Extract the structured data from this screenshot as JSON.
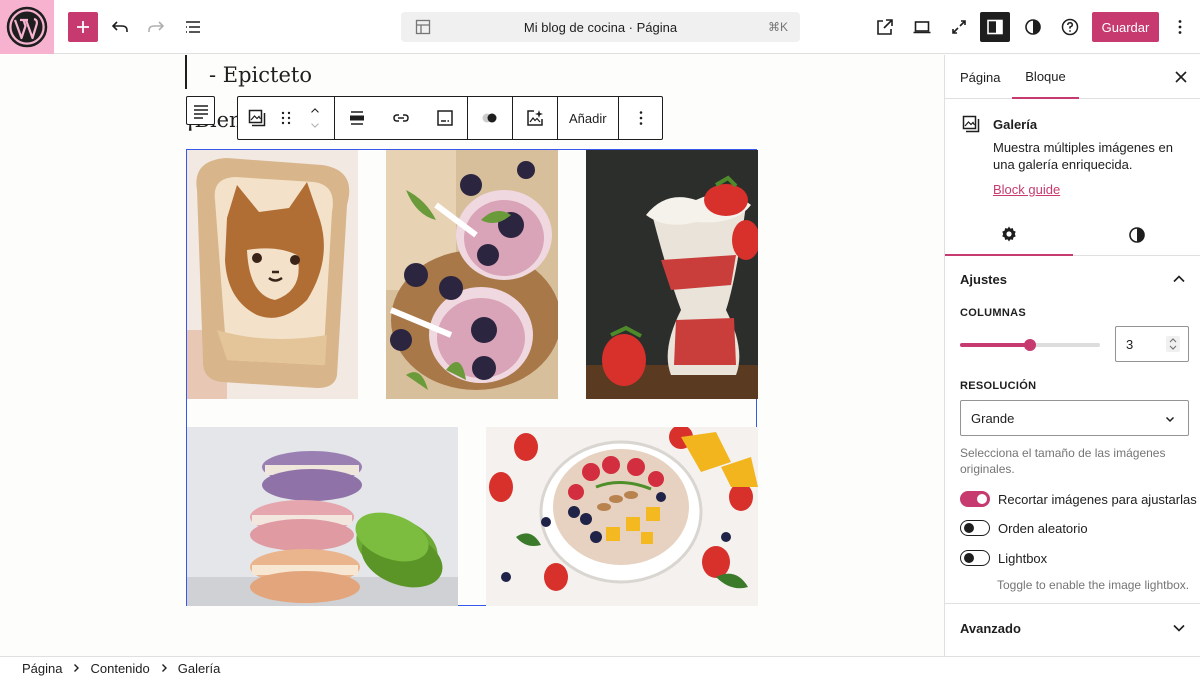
{
  "header": {
    "site_title": "Mi blog de cocina · Página",
    "shortcut": "⌘K",
    "save_label": "Guardar"
  },
  "canvas": {
    "quote_citation": "- Epicteto",
    "heading_fragment": "¡Bienv",
    "block_toolbar": {
      "add_label": "Añadir"
    }
  },
  "sidebar": {
    "tabs": [
      {
        "label": "Página"
      },
      {
        "label": "Bloque"
      }
    ],
    "block": {
      "title": "Galería",
      "description": "Muestra múltiples imágenes en una galería enriquecida.",
      "guide_link": "Block guide"
    },
    "settings_panel": {
      "title": "Ajustes",
      "columns_label": "Columnas",
      "columns_value": "3",
      "columns_fraction": 0.5,
      "resolution_label": "Resolución",
      "resolution_value": "Grande",
      "resolution_help": "Selecciona el tamaño de las imágenes originales.",
      "toggles": [
        {
          "label": "Recortar imágenes para ajustarlas",
          "on": true
        },
        {
          "label": "Orden aleatorio",
          "on": false
        },
        {
          "label": "Lightbox",
          "on": false
        }
      ],
      "lightbox_help": "Toggle to enable the image lightbox."
    },
    "advanced_panel": {
      "title": "Avanzado"
    }
  },
  "breadcrumb": [
    {
      "label": "Página"
    },
    {
      "label": "Contenido"
    },
    {
      "label": "Galería"
    }
  ],
  "colors": {
    "accent": "#c63a6f",
    "selection_outline": "#3858e9"
  }
}
